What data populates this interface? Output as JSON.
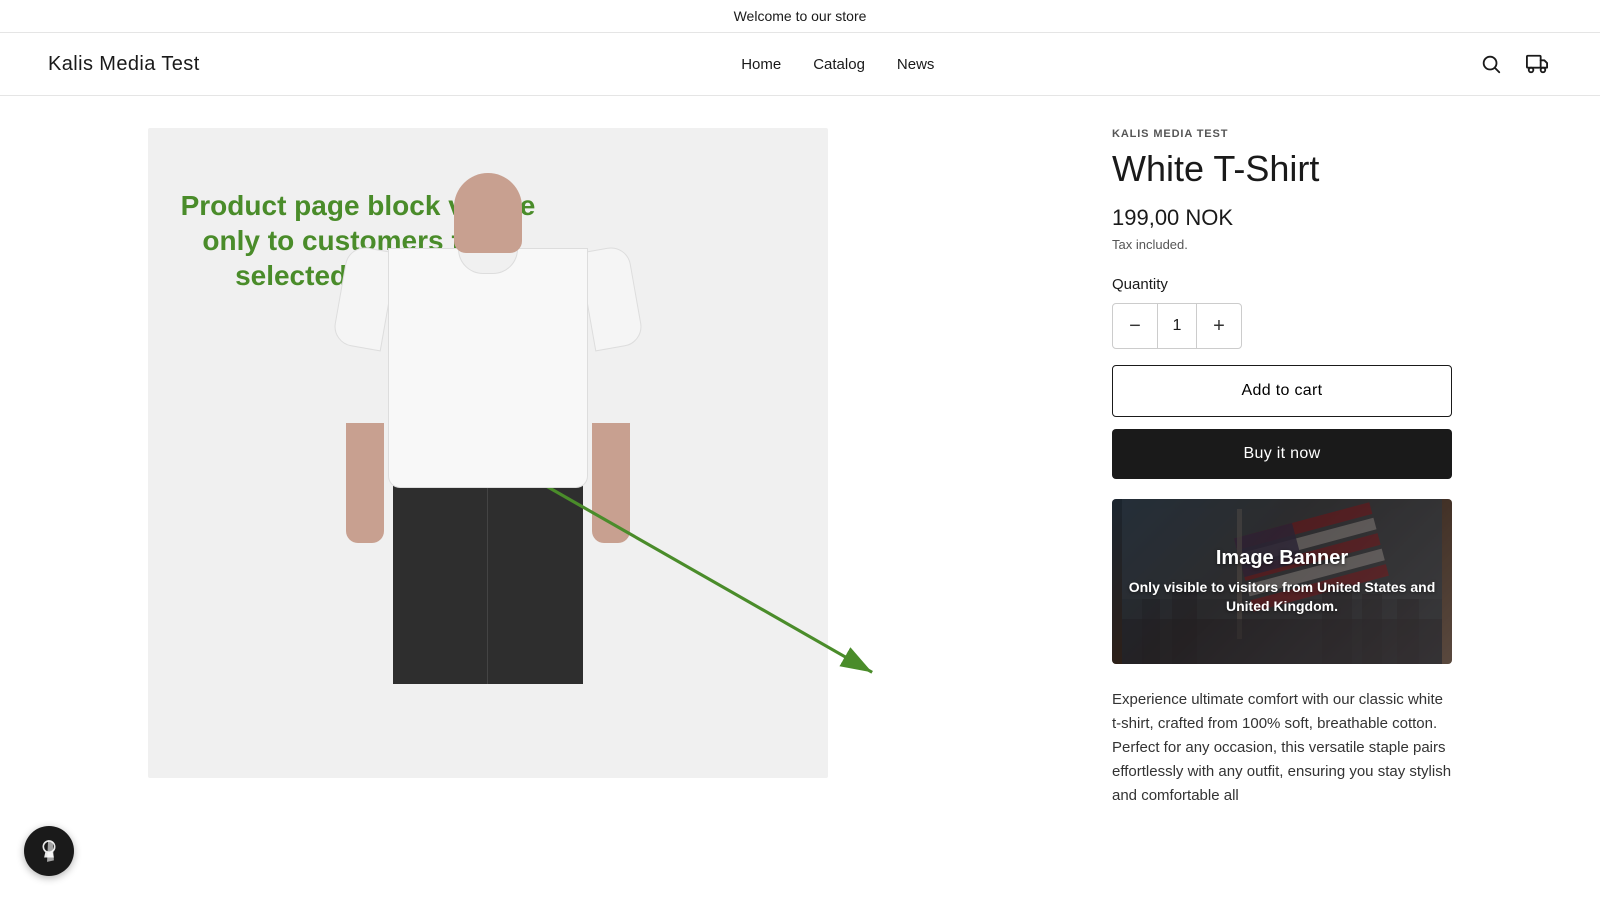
{
  "announcement": {
    "text": "Welcome to our store"
  },
  "header": {
    "logo": "Kalis Media Test",
    "nav": [
      {
        "label": "Home",
        "href": "#"
      },
      {
        "label": "Catalog",
        "href": "#"
      },
      {
        "label": "News",
        "href": "#"
      }
    ]
  },
  "product": {
    "brand": "KALIS MEDIA TEST",
    "title": "White T-Shirt",
    "price": "199,00 NOK",
    "tax_note": "Tax included.",
    "quantity_label": "Quantity",
    "quantity_value": "1",
    "add_to_cart_label": "Add to cart",
    "buy_now_label": "Buy it now",
    "description": "Experience ultimate comfort with our classic white t-shirt, crafted from 100% soft, breathable cotton. Perfect for any occasion, this versatile staple pairs effortlessly with any outfit, ensuring you stay stylish and comfortable all"
  },
  "annotation": {
    "text": "Product page block visible only to customers from selected countries"
  },
  "image_banner": {
    "title": "Image Banner",
    "subtitle": "Only visible to visitors from United States and United Kingdom."
  },
  "quantity_decrease_label": "−",
  "quantity_increase_label": "+"
}
